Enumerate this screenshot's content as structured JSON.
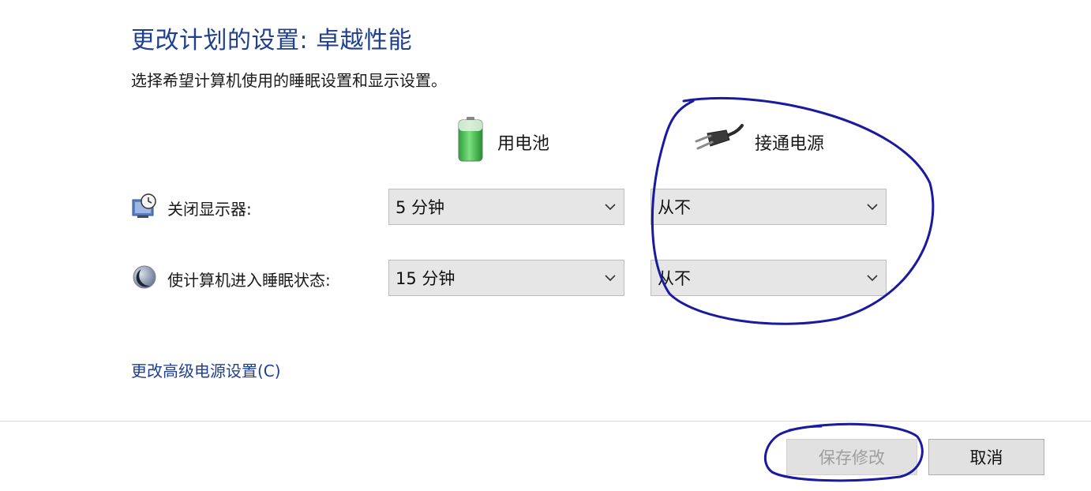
{
  "header": {
    "title": "更改计划的设置: 卓越性能",
    "subtitle": "选择希望计算机使用的睡眠设置和显示设置。"
  },
  "columns": {
    "battery": {
      "label": "用电池",
      "icon": "battery-icon"
    },
    "plugged": {
      "label": "接通电源",
      "icon": "power-plug-icon"
    }
  },
  "settings": [
    {
      "label": "关闭显示器:",
      "icon": "display-timer-icon",
      "battery_value": "5 分钟",
      "plugged_value": "从不"
    },
    {
      "label": "使计算机进入睡眠状态:",
      "icon": "sleep-moon-icon",
      "battery_value": "15 分钟",
      "plugged_value": "从不"
    }
  ],
  "links": {
    "advanced": "更改高级电源设置(C)"
  },
  "buttons": {
    "save": "保存修改",
    "cancel": "取消"
  },
  "colors": {
    "title_blue": "#1f3f8f",
    "annotation_ink": "#1a1aa0",
    "battery_green": "#3fbf4f"
  }
}
